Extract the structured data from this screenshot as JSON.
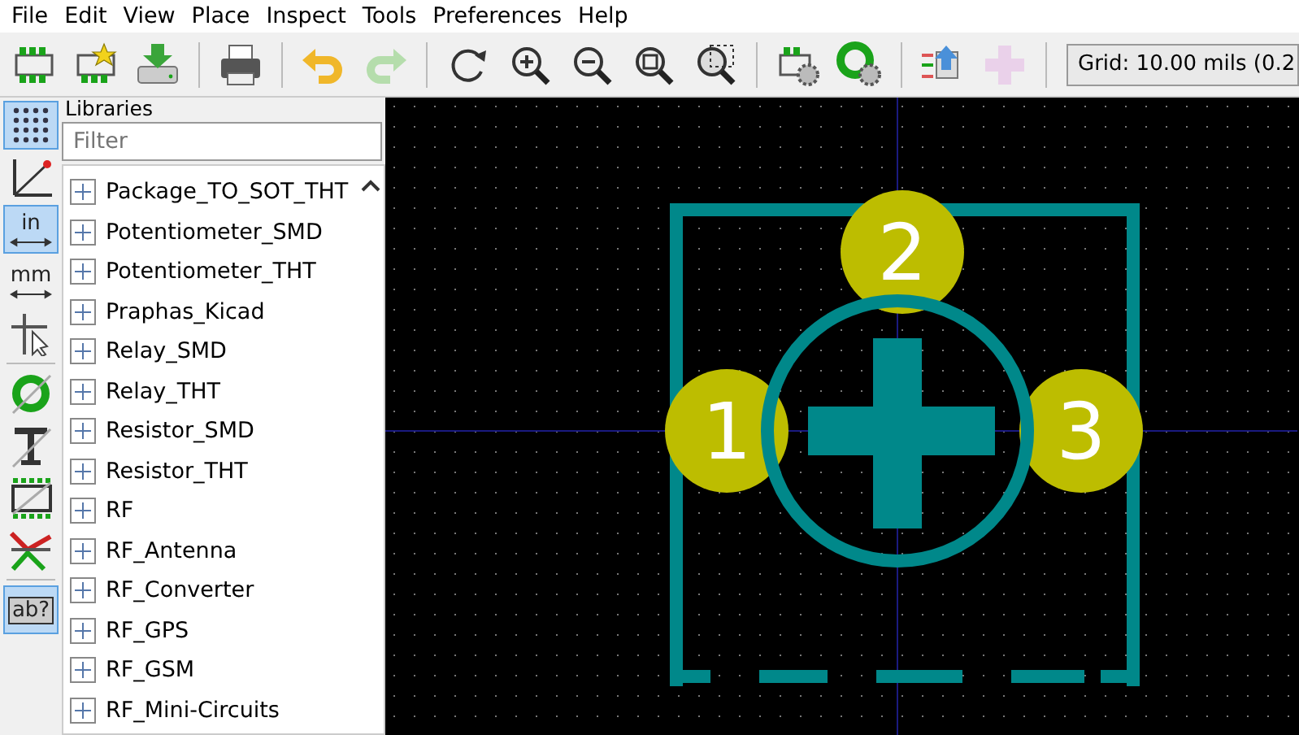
{
  "menu": [
    "File",
    "Edit",
    "View",
    "Place",
    "Inspect",
    "Tools",
    "Preferences",
    "Help"
  ],
  "toolbar": [
    [
      {
        "kind": "footprint",
        "disabled": false
      },
      {
        "kind": "new-footprint",
        "disabled": false
      },
      {
        "kind": "save",
        "disabled": false
      }
    ],
    [
      {
        "kind": "print",
        "disabled": false
      }
    ],
    [
      {
        "kind": "undo",
        "disabled": false
      },
      {
        "kind": "redo",
        "disabled": true
      }
    ],
    [
      {
        "kind": "refresh",
        "disabled": false
      },
      {
        "kind": "zoom-in",
        "disabled": false
      },
      {
        "kind": "zoom-out",
        "disabled": false
      },
      {
        "kind": "zoom-fit",
        "disabled": false
      },
      {
        "kind": "zoom-area",
        "disabled": false
      }
    ],
    [
      {
        "kind": "footprint-settings",
        "disabled": false
      },
      {
        "kind": "pad-settings",
        "disabled": false
      }
    ],
    [
      {
        "kind": "update",
        "disabled": false
      },
      {
        "kind": "add",
        "disabled": true
      }
    ]
  ],
  "grid_select": {
    "value": "Grid: 10.00 mils (0.2"
  },
  "left_tools": [
    [
      {
        "kind": "grid",
        "selected": true
      },
      {
        "kind": "polar",
        "selected": false
      },
      {
        "kind": "unit",
        "label": "in",
        "selected": true
      },
      {
        "kind": "unit",
        "label": "mm",
        "selected": false
      },
      {
        "kind": "cursor",
        "selected": false
      }
    ],
    [
      {
        "kind": "pad",
        "selected": false
      },
      {
        "kind": "text",
        "selected": false
      },
      {
        "kind": "keepout",
        "selected": false
      },
      {
        "kind": "tracks",
        "selected": false
      }
    ],
    [
      {
        "kind": "textbox",
        "label": "ab?",
        "selected": true
      }
    ]
  ],
  "libraries": {
    "title": "Libraries",
    "placeholder": "Filter",
    "items": [
      "Package_TO_SOT_THT",
      "Potentiometer_SMD",
      "Potentiometer_THT",
      "Praphas_Kicad",
      "Relay_SMD",
      "Relay_THT",
      "Resistor_SMD",
      "Resistor_THT",
      "RF",
      "RF_Antenna",
      "RF_Converter",
      "RF_GPS",
      "RF_GSM",
      "RF_Mini-Circuits"
    ]
  },
  "canvas": {
    "pads": [
      "1",
      "2",
      "3"
    ]
  }
}
